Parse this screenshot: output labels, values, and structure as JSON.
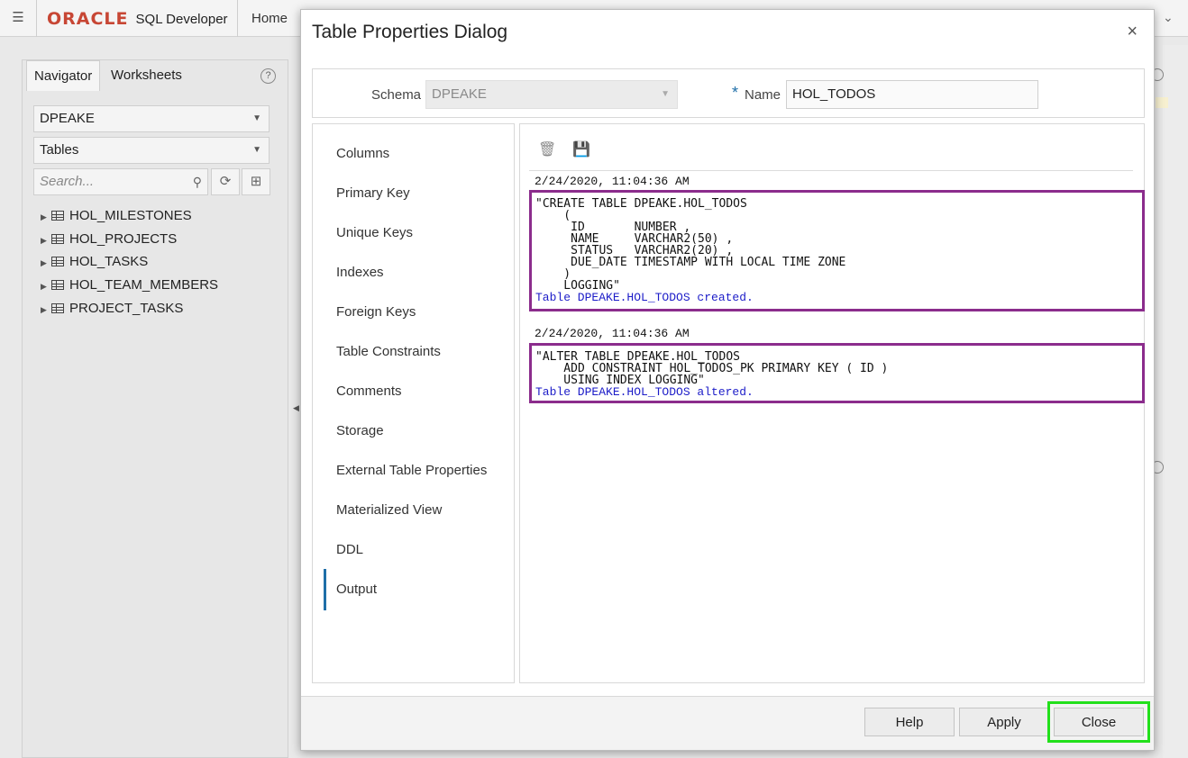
{
  "app": {
    "brand_oracle": "ORACLE",
    "brand_product": "SQL Developer",
    "home_label": "Home",
    "menu_icon": "hamburger-icon",
    "chevron_icon": "chevron-down-icon"
  },
  "navigator": {
    "tabs": [
      {
        "label": "Navigator",
        "active": true
      },
      {
        "label": "Worksheets",
        "active": false
      }
    ],
    "help_glyph": "?",
    "schema_value": "DPEAKE",
    "object_type_value": "Tables",
    "search_placeholder": "Search...",
    "tree": [
      {
        "label": "HOL_MILESTONES"
      },
      {
        "label": "HOL_PROJECTS"
      },
      {
        "label": "HOL_TASKS"
      },
      {
        "label": "HOL_TEAM_MEMBERS"
      },
      {
        "label": "PROJECT_TASKS"
      }
    ]
  },
  "dialog": {
    "title": "Table Properties Dialog",
    "close_glyph": "×",
    "schema_label": "Schema",
    "schema_value": "DPEAKE",
    "name_required_mark": "*",
    "name_label": "Name",
    "name_value": "HOL_TODOS",
    "nav_items": [
      {
        "label": "Columns"
      },
      {
        "label": "Primary Key"
      },
      {
        "label": "Unique Keys"
      },
      {
        "label": "Indexes"
      },
      {
        "label": "Foreign Keys"
      },
      {
        "label": "Table Constraints"
      },
      {
        "label": "Comments"
      },
      {
        "label": "Storage"
      },
      {
        "label": "External Table Properties"
      },
      {
        "label": "Materialized View"
      },
      {
        "label": "DDL"
      },
      {
        "label": "Output",
        "active": true
      }
    ],
    "output": {
      "entries": [
        {
          "timestamp": "2/24/2020, 11:04:36 AM",
          "sql": "\"CREATE TABLE DPEAKE.HOL_TODOS\n    (\n     ID       NUMBER ,\n     NAME     VARCHAR2(50) ,\n     STATUS   VARCHAR2(20) ,\n     DUE_DATE TIMESTAMP WITH LOCAL TIME ZONE\n    )\n    LOGGING\"",
          "message": "Table DPEAKE.HOL_TODOS created."
        },
        {
          "timestamp": "2/24/2020, 11:04:36 AM",
          "sql": "\"ALTER TABLE DPEAKE.HOL_TODOS\n    ADD CONSTRAINT HOL_TODOS_PK PRIMARY KEY ( ID )\n    USING INDEX LOGGING\"",
          "message": "Table DPEAKE.HOL_TODOS altered."
        }
      ]
    },
    "footer": {
      "help_label": "Help",
      "apply_label": "Apply",
      "close_label": "Close"
    },
    "colors": {
      "highlight_box": "#8b2c8c",
      "close_highlight": "#22e01b",
      "message_text": "#1c1cc8",
      "accent": "#1f6fa8"
    }
  }
}
